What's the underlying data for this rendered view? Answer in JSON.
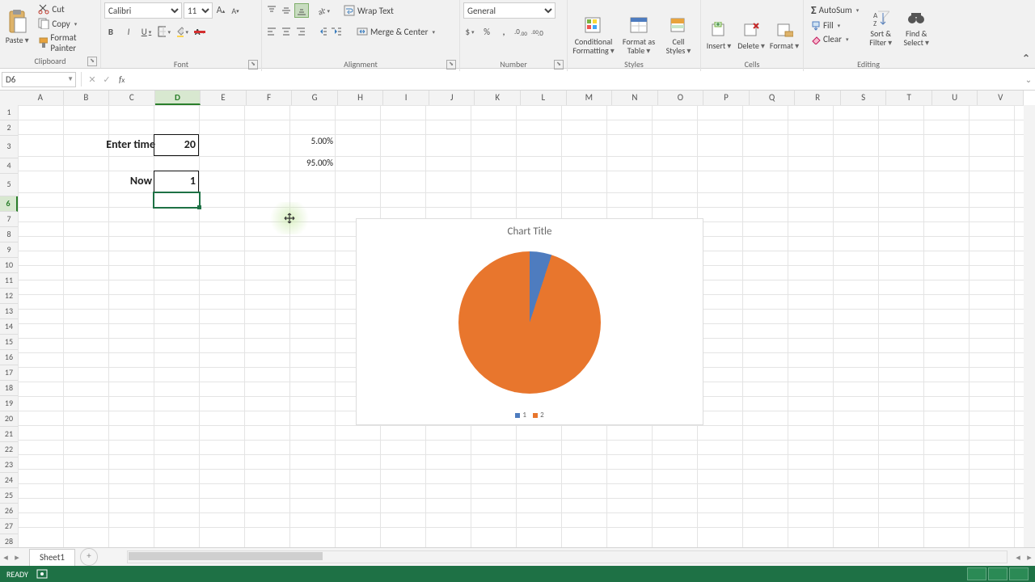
{
  "ribbon": {
    "clipboard": {
      "label": "Clipboard",
      "paste": "Paste",
      "cut": "Cut",
      "copy": "Copy",
      "format_painter": "Format Painter"
    },
    "font": {
      "label": "Font",
      "name": "Calibri",
      "size": "11"
    },
    "alignment": {
      "label": "Alignment",
      "wrap": "Wrap Text",
      "merge": "Merge & Center"
    },
    "number": {
      "label": "Number",
      "format": "General"
    },
    "styles": {
      "label": "Styles",
      "conditional": "Conditional Formatting",
      "table": "Format as Table",
      "cell": "Cell Styles"
    },
    "cells": {
      "label": "Cells",
      "insert": "Insert",
      "delete": "Delete",
      "format": "Format"
    },
    "editing": {
      "label": "Editing",
      "autosum": "AutoSum",
      "fill": "Fill",
      "clear": "Clear",
      "sort": "Sort & Filter",
      "find": "Find & Select"
    }
  },
  "namebox": "D6",
  "sheet": {
    "columns": [
      "A",
      "B",
      "C",
      "D",
      "E",
      "F",
      "G",
      "H",
      "I",
      "J",
      "K",
      "L",
      "M",
      "N",
      "O",
      "P",
      "Q",
      "R",
      "S",
      "T",
      "U",
      "V"
    ],
    "rows": [
      "1",
      "2",
      "3",
      "4",
      "5",
      "6",
      "7",
      "8",
      "9",
      "10",
      "11",
      "12",
      "13",
      "14",
      "15",
      "16",
      "17",
      "18",
      "19",
      "20",
      "21",
      "22",
      "23",
      "24",
      "25",
      "26",
      "27",
      "28"
    ],
    "cells": {
      "c3": "Enter time",
      "d3": "20",
      "g3": "5.00%",
      "g4": "95.00%",
      "c5": "Now",
      "d5": "1"
    },
    "active": "D6",
    "selected_col": "D",
    "selected_row": "6",
    "tall_rows": [
      "3",
      "5"
    ]
  },
  "chart_data": {
    "type": "pie",
    "title": "Chart Title",
    "categories": [
      "1",
      "2"
    ],
    "values": [
      5,
      95
    ],
    "colors": [
      "#4e7cbf",
      "#e8762d"
    ],
    "legend_position": "bottom"
  },
  "tabs": {
    "sheet1": "Sheet1"
  },
  "status": {
    "ready": "READY"
  }
}
